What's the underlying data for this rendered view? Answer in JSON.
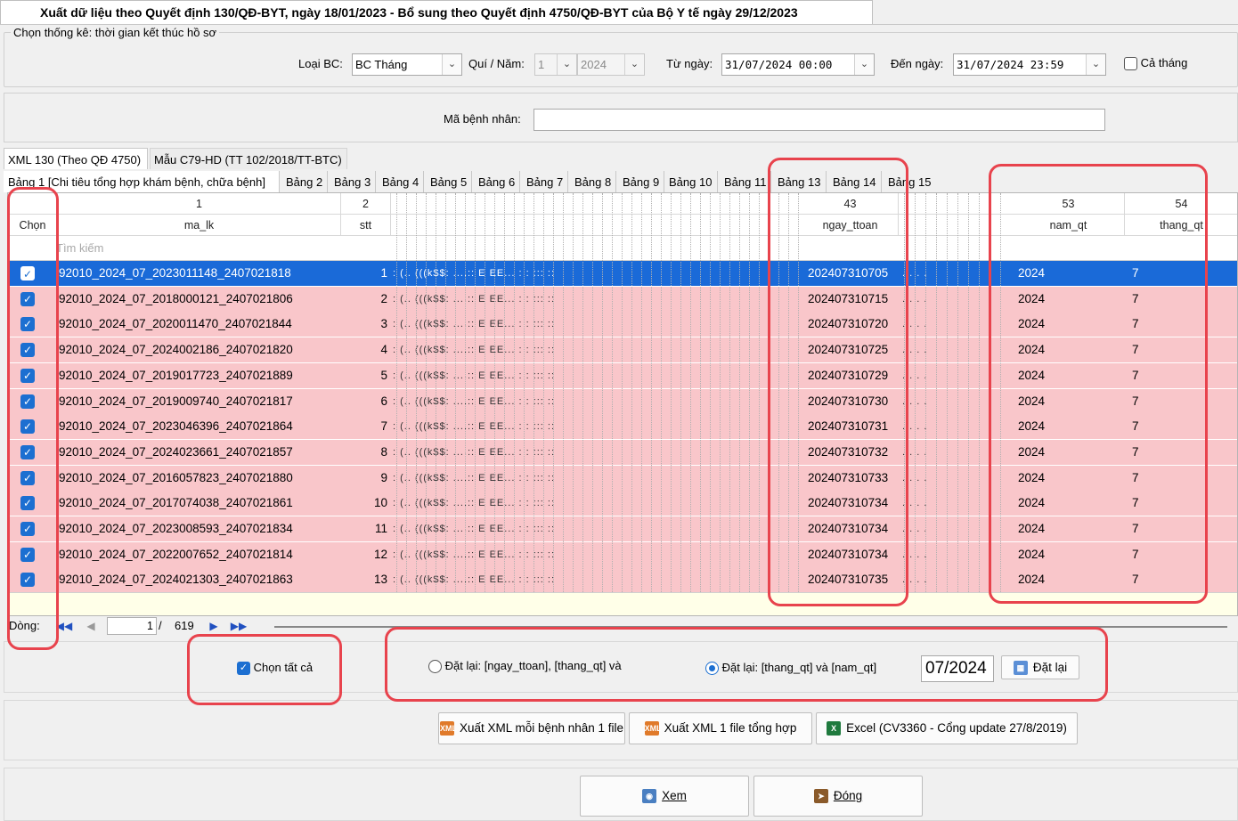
{
  "window": {
    "title": "Xuất dữ liệu theo Quyết định 130/QĐ-BYT, ngày 18/01/2023 - Bổ sung theo Quyết định 4750/QĐ-BYT của Bộ Y tế ngày 29/12/2023"
  },
  "filter": {
    "group_label": "Chọn thống kê: thời gian kết thúc hồ sơ",
    "loai_bc_label": "Loại BC:",
    "loai_bc_value": "BC Tháng",
    "qui_nam_label": "Quí / Năm:",
    "qui_value": "1",
    "nam_value": "2024",
    "tu_ngay_label": "Từ ngày:",
    "tu_ngay_value": "31/07/2024 00:00",
    "den_ngay_label": "Đến ngày:",
    "den_ngay_value": "31/07/2024 23:59",
    "ca_thang_label": "Cả tháng",
    "ma_benh_nhan_label": "Mã bệnh nhân:",
    "ma_benh_nhan_value": ""
  },
  "format_tabs": [
    "XML 130 (Theo QĐ 4750)",
    "Mẫu C79-HD (TT 102/2018/TT-BTC)"
  ],
  "table_tabs": [
    "Bảng 1 [Chi tiêu tổng hợp khám bệnh, chữa bệnh]",
    "Bảng 2",
    "Bảng 3",
    "Bảng 4",
    "Bảng 5",
    "Bảng 6",
    "Bảng 7",
    "Bảng 8",
    "Bảng 9",
    "Bảng 10",
    "Bảng 11",
    "Bảng 13",
    "Bảng 14",
    "Bảng 15"
  ],
  "grid": {
    "col_numbers": {
      "ma_lk": "1",
      "stt": "2",
      "ngay_ttoan": "43",
      "nam_qt": "53",
      "thang_qt": "54"
    },
    "col_names": {
      "chon": "Chọn",
      "ma_lk": "ma_lk",
      "stt": "stt",
      "ngay_ttoan": "ngay_ttoan",
      "nam_qt": "nam_qt",
      "thang_qt": "thang_qt"
    },
    "search_placeholder": "Tìm kiếm",
    "rows": [
      {
        "ma_lk": "92010_2024_07_2023011148_2407021818",
        "stt": "1",
        "ngay_ttoan": "202407310705",
        "nam_qt": "2024",
        "thang_qt": "7"
      },
      {
        "ma_lk": "92010_2024_07_2018000121_2407021806",
        "stt": "2",
        "ngay_ttoan": "202407310715",
        "nam_qt": "2024",
        "thang_qt": "7"
      },
      {
        "ma_lk": "92010_2024_07_2020011470_2407021844",
        "stt": "3",
        "ngay_ttoan": "202407310720",
        "nam_qt": "2024",
        "thang_qt": "7"
      },
      {
        "ma_lk": "92010_2024_07_2024002186_2407021820",
        "stt": "4",
        "ngay_ttoan": "202407310725",
        "nam_qt": "2024",
        "thang_qt": "7"
      },
      {
        "ma_lk": "92010_2024_07_2019017723_2407021889",
        "stt": "5",
        "ngay_ttoan": "202407310729",
        "nam_qt": "2024",
        "thang_qt": "7"
      },
      {
        "ma_lk": "92010_2024_07_2019009740_2407021817",
        "stt": "6",
        "ngay_ttoan": "202407310730",
        "nam_qt": "2024",
        "thang_qt": "7"
      },
      {
        "ma_lk": "92010_2024_07_2023046396_2407021864",
        "stt": "7",
        "ngay_ttoan": "202407310731",
        "nam_qt": "2024",
        "thang_qt": "7"
      },
      {
        "ma_lk": "92010_2024_07_2024023661_2407021857",
        "stt": "8",
        "ngay_ttoan": "202407310732",
        "nam_qt": "2024",
        "thang_qt": "7"
      },
      {
        "ma_lk": "92010_2024_07_2016057823_2407021880",
        "stt": "9",
        "ngay_ttoan": "202407310733",
        "nam_qt": "2024",
        "thang_qt": "7"
      },
      {
        "ma_lk": "92010_2024_07_2017074038_2407021861",
        "stt": "10",
        "ngay_ttoan": "202407310734",
        "nam_qt": "2024",
        "thang_qt": "7"
      },
      {
        "ma_lk": "92010_2024_07_2023008593_2407021834",
        "stt": "11",
        "ngay_ttoan": "202407310734",
        "nam_qt": "2024",
        "thang_qt": "7"
      },
      {
        "ma_lk": "92010_2024_07_2022007652_2407021814",
        "stt": "12",
        "ngay_ttoan": "202407310734",
        "nam_qt": "2024",
        "thang_qt": "7"
      },
      {
        "ma_lk": "92010_2024_07_2024021303_2407021863",
        "stt": "13",
        "ngay_ttoan": "202407310735",
        "nam_qt": "2024",
        "thang_qt": "7"
      }
    ]
  },
  "pager": {
    "label": "Dòng:",
    "current": "1",
    "sep": "/",
    "total": "619"
  },
  "options": {
    "chon_tat_ca": "Chọn tất cả",
    "reset1": "Đặt lại: [ngay_ttoan], [thang_qt] và",
    "reset2": "Đặt lại: [thang_qt] và [nam_qt]",
    "month_value": "07/2024",
    "dat_lai_btn": "Đặt lại"
  },
  "exports": {
    "xml_each": "Xuất XML mỗi bệnh nhân 1 file",
    "xml_one": "Xuất XML 1 file tổng hợp",
    "excel": "Excel (CV3360 - Cổng update 27/8/2019)"
  },
  "actions": {
    "xem": "Xem",
    "dong": "Đóng"
  },
  "colors": {
    "row_bg": "#f9c6ca",
    "selected_row": "#1a6ad8",
    "highlight": "#e8434d"
  }
}
